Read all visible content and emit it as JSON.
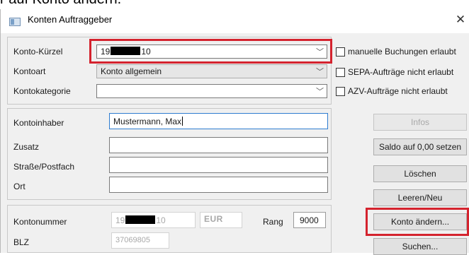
{
  "caption_fragment": "r auf Konto ändern.",
  "window": {
    "title": "Konten Auftraggeber",
    "close_glyph": "✕"
  },
  "account": {
    "kuerzel_label": "Konto-Kürzel",
    "kuerzel_prefix": "19",
    "kuerzel_suffix": "10",
    "kontoart_label": "Kontoart",
    "kontoart_value": "Konto allgemein",
    "kontokategorie_label": "Kontokategorie",
    "kontokategorie_value": ""
  },
  "options": {
    "manuelle_buchungen": "manuelle Buchungen erlaubt",
    "sepa": "SEPA-Aufträge nicht erlaubt",
    "azv": "AZV-Aufträge nicht erlaubt"
  },
  "holder": {
    "kontoinhaber_label": "Kontoinhaber",
    "kontoinhaber_value": "Mustermann, Max",
    "zusatz_label": "Zusatz",
    "zusatz_value": "",
    "strasse_label": "Straße/Postfach",
    "strasse_value": "",
    "ort_label": "Ort",
    "ort_value": ""
  },
  "bank": {
    "kontonummer_label": "Kontonummer",
    "kontonummer_prefix": "19",
    "kontonummer_suffix": "10",
    "currency": "EUR",
    "rang_label": "Rang",
    "rang_value": "9000",
    "blz_label": "BLZ",
    "blz_value": "37069805"
  },
  "buttons": {
    "infos": "Infos",
    "saldo": "Saldo auf 0,00 setzen",
    "loeschen": "Löschen",
    "leeren": "Leeren/Neu",
    "konto_aendern": "Konto ändern...",
    "suchen": "Suchen..."
  },
  "chevron_glyph": "﹀",
  "colors": {
    "highlight": "#d4232e",
    "focus_border": "#2d7cd0"
  }
}
